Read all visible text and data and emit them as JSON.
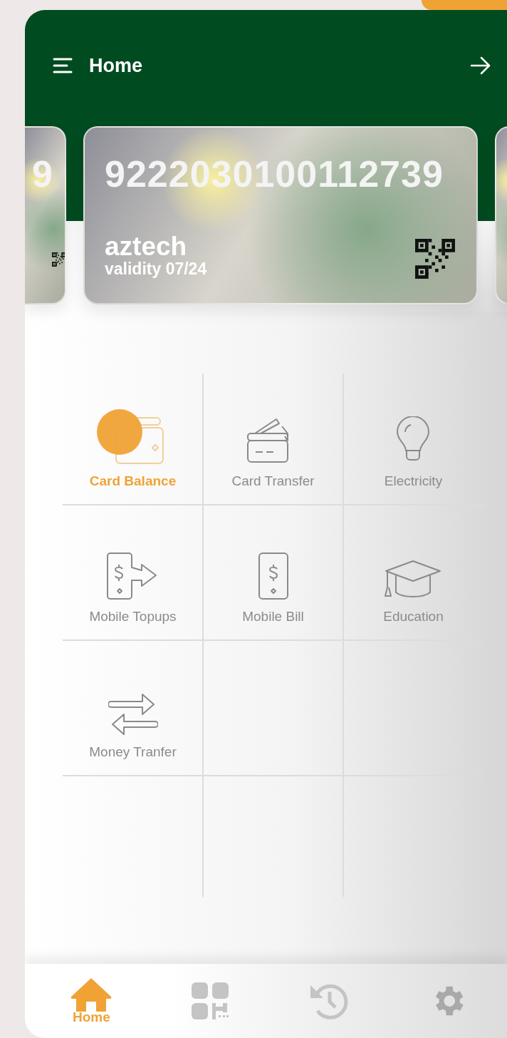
{
  "header": {
    "title": "Home"
  },
  "cards": [
    {
      "kind": "peek-left",
      "number": "9"
    },
    {
      "kind": "full",
      "number": "9222030100112739",
      "name": "aztech",
      "validity": "validity 07/24"
    },
    {
      "kind": "peek-right"
    }
  ],
  "services": [
    {
      "kind": "card-balance",
      "label": "Card Balance",
      "selected": true
    },
    {
      "kind": "card-transfer",
      "label": "Card Transfer",
      "selected": false
    },
    {
      "kind": "electricity",
      "label": "Electricity",
      "selected": false
    },
    {
      "kind": "mobile-topup",
      "label": "Mobile Topups",
      "selected": false
    },
    {
      "kind": "mobile-bill",
      "label": "Mobile Bill",
      "selected": false
    },
    {
      "kind": "education",
      "label": "Education",
      "selected": false
    },
    {
      "kind": "money-transfer",
      "label": "Money Tranfer",
      "selected": false
    }
  ],
  "nav": [
    {
      "kind": "home",
      "label": "Home",
      "selected": true
    },
    {
      "kind": "qr",
      "selected": false
    },
    {
      "kind": "history",
      "selected": false
    },
    {
      "kind": "settings",
      "selected": false
    }
  ]
}
